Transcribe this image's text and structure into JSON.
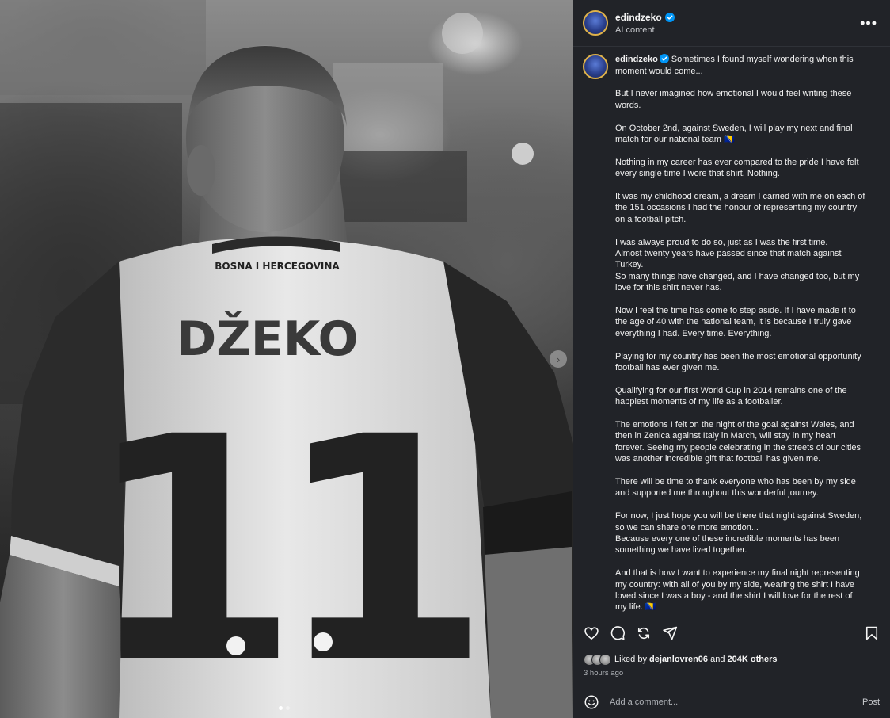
{
  "header": {
    "username": "edindzeko",
    "subtitle": "AI content"
  },
  "media": {
    "jersey_top": "BOSNA I HERCEGOVINA",
    "jersey_name": "DŽEKO",
    "jersey_number": "11",
    "slides": 2,
    "current_slide": 1
  },
  "caption": {
    "username": "edindzeko",
    "paragraphs": [
      "Sometimes I found myself wondering when this moment would come...",
      "But I never imagined how emotional I would feel writing these words.",
      "On October 2nd, against Sweden, I will play my next and final match for our national team 🇧🇦",
      "Nothing in my career has ever compared to the pride I have felt every single time I wore that shirt. Nothing.",
      "It was my childhood dream, a dream I carried with me on each of the 151 occasions I had the honour of representing my country on a football pitch.",
      "I was always proud to do so, just as I was the first time.\nAlmost twenty years have passed since that match against Turkey.\nSo many things have changed, and I have changed too, but my love for this shirt never has.",
      "Now I feel the time has come to step aside. If I have made it to the age of 40 with the national team, it is because I truly gave everything I had. Every time. Everything.",
      "Playing for my country has been the most emotional opportunity football has ever given me.",
      "Qualifying for our first World Cup in 2014 remains one of the happiest moments of my life as a footballer.",
      "The emotions I felt on the night of the goal against Wales, and then in Zenica against Italy in March, will stay in my heart forever. Seeing my people celebrating in the streets of our cities was another incredible gift that football has given me.",
      "There will be time to thank everyone who has been by my side and supported me throughout this wonderful journey.",
      "For now, I just hope you will be there that night against Sweden, so we can share one more emotion...\nBecause every one of these incredible moments has been something we have lived together.",
      "And that is how I want to experience my final night representing my country: with all of you by my side, wearing the shirt I have loved since I was a boy - and the shirt I will love for the rest of my life. 🇧🇦"
    ]
  },
  "likes": {
    "prefix": "Liked by",
    "user": "dejanlovren06",
    "connector": "and",
    "others": "204K others"
  },
  "time": "3 hours ago",
  "comment": {
    "placeholder": "Add a comment...",
    "post_label": "Post"
  },
  "icons": {
    "more": "more-options-icon",
    "verified": "verified-badge-icon",
    "like": "heart-icon",
    "comment": "comment-icon",
    "repost": "repost-icon",
    "share": "share-icon",
    "save": "bookmark-icon",
    "emoji": "emoji-icon",
    "next": "chevron-right-icon"
  },
  "colors": {
    "panel_bg": "#212328",
    "verified": "#0095f6",
    "text": "#f5f5f5",
    "muted": "#b0b3b8"
  }
}
